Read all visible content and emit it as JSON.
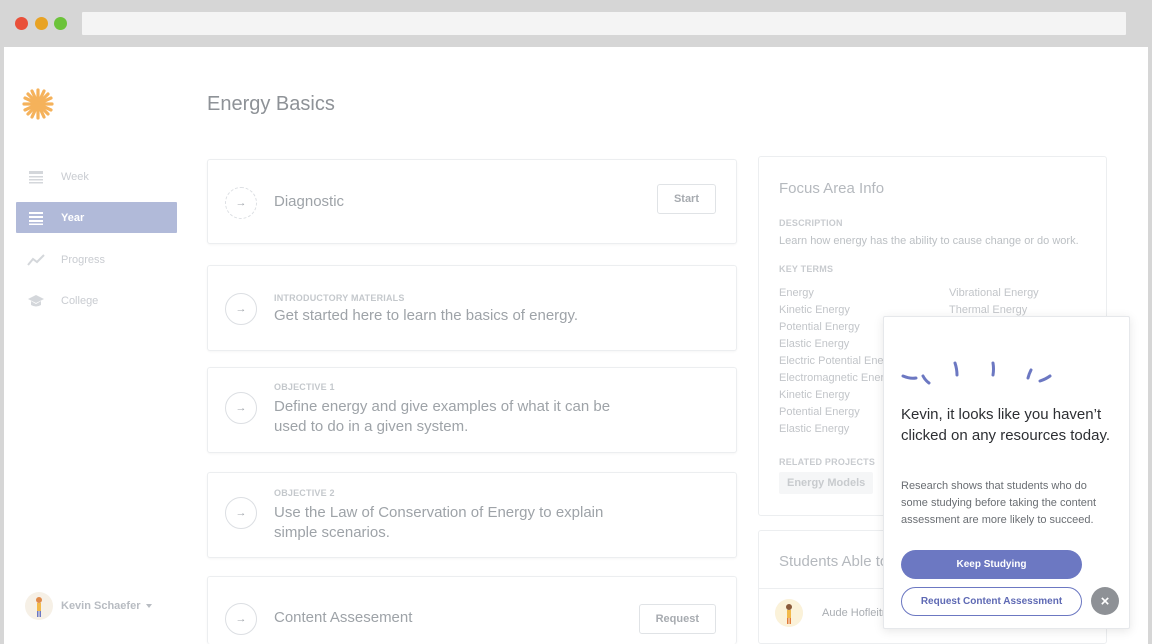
{
  "page": {
    "title": "Energy Basics"
  },
  "sidebar": {
    "items": [
      {
        "label": "Week",
        "icon": "calendar-week-icon"
      },
      {
        "label": "Year",
        "icon": "list-icon",
        "active": true
      },
      {
        "label": "Progress",
        "icon": "trend-line-icon"
      },
      {
        "label": "College",
        "icon": "graduation-cap-icon"
      }
    ],
    "user": {
      "name": "Kevin Schaefer"
    }
  },
  "cards": {
    "diagnostic": {
      "title": "Diagnostic",
      "button": "Start"
    },
    "intro": {
      "kicker": "INTRODUCTORY MATERIALS",
      "text": "Get started here to learn the basics of energy."
    },
    "objective1": {
      "kicker": "OBJECTIVE 1",
      "text": "Define energy and give examples of what it can be used to do in a given system."
    },
    "objective2": {
      "kicker": "OBJECTIVE 2",
      "text": "Use the Law of Conservation of Energy to explain simple scenarios."
    },
    "assessment": {
      "title": "Content Assesement",
      "button": "Request"
    }
  },
  "info": {
    "title": "Focus Area Info",
    "description_label": "DESCRIPTION",
    "description": "Learn how energy has the ability to cause change or do work.",
    "key_terms_label": "KEY TERMS",
    "terms_left": [
      "Energy",
      "Kinetic Energy",
      "Potential Energy",
      "Elastic Energy",
      "Electric Potential Ene",
      "Electromagnetic Ener",
      "Kinetic Energy",
      "Potential Energy",
      "Elastic Energy"
    ],
    "terms_right": [
      "Vibrational Energy",
      "Thermal Energy"
    ],
    "related_label": "RELATED PROJECTS",
    "related_project": "Energy Models"
  },
  "students": {
    "title": "Students Able to",
    "first_student": "Aude Hofleitne"
  },
  "popup": {
    "heading": "Kevin, it looks like you haven’t clicked on any resources today.",
    "body": "Research shows that students who do some studying before taking the content assessment are more likely to succeed.",
    "primary_button": "Keep Studying",
    "secondary_button": "Request Content Assessment",
    "close_icon": "×"
  },
  "colors": {
    "accent": "#6c78c2",
    "nav_active": "#b1bad9",
    "logo": "#f5b25b"
  }
}
